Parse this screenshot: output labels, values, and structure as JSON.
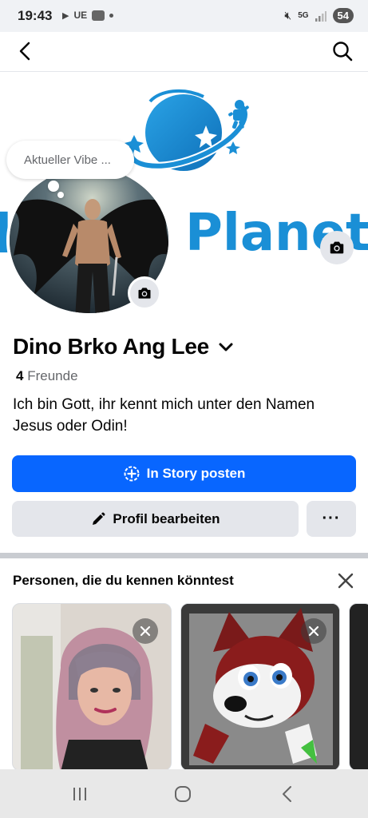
{
  "status_bar": {
    "time": "19:43",
    "carrier": "UE",
    "network": "5G",
    "battery": "54"
  },
  "cover": {
    "logo_text": "Planet"
  },
  "vibe_prompt": "Aktueller Vibe ...",
  "profile": {
    "name": "Dino Brko Ang Lee",
    "friends_count": "4",
    "friends_label": "Freunde",
    "bio": "Ich bin Gott, ihr kennt mich unter den Namen Jesus oder Odin!"
  },
  "actions": {
    "story_label": "In Story posten",
    "edit_label": "Profil bearbeiten",
    "more_label": "···"
  },
  "suggestions": {
    "title": "Personen, die du kennen könntest"
  },
  "colors": {
    "primary_blue": "#0866ff",
    "logo_blue": "#1a8fd6",
    "secondary_bg": "#e4e6eb"
  }
}
